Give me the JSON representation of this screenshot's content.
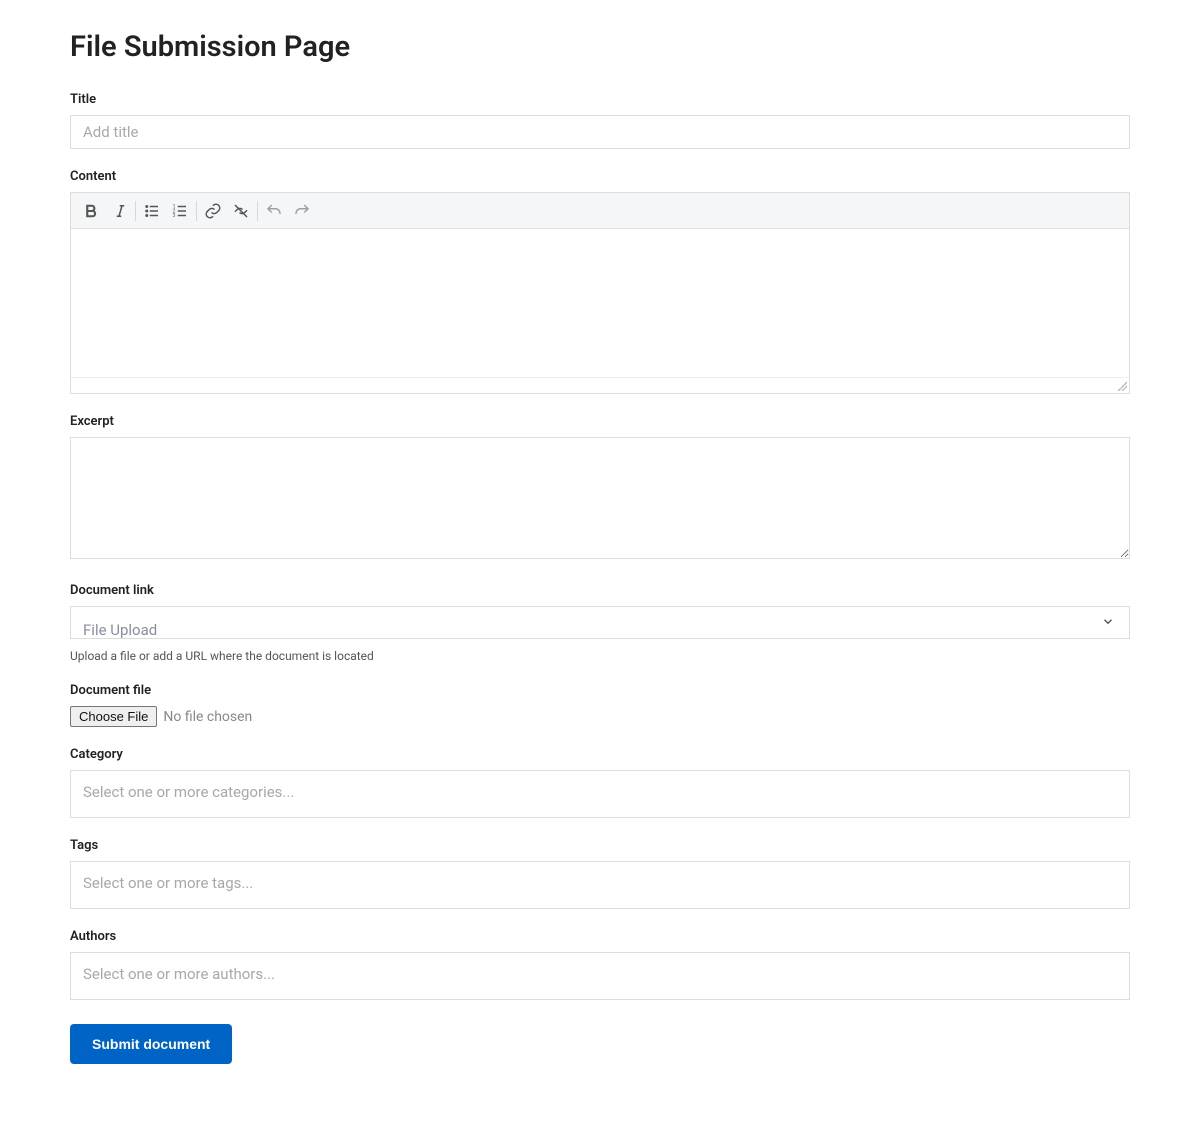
{
  "page": {
    "title": "File Submission Page"
  },
  "fields": {
    "title": {
      "label": "Title",
      "placeholder": "Add title",
      "value": ""
    },
    "content": {
      "label": "Content",
      "value": ""
    },
    "excerpt": {
      "label": "Excerpt",
      "value": ""
    },
    "document_link": {
      "label": "Document link",
      "selected": "File Upload",
      "helper": "Upload a file or add a URL where the document is located"
    },
    "document_file": {
      "label": "Document file",
      "button": "Choose File",
      "status": "No file chosen"
    },
    "category": {
      "label": "Category",
      "placeholder": "Select one or more categories..."
    },
    "tags": {
      "label": "Tags",
      "placeholder": "Select one or more tags..."
    },
    "authors": {
      "label": "Authors",
      "placeholder": "Select one or more authors..."
    }
  },
  "toolbar": {
    "buttons": [
      "bold",
      "italic",
      "bullet-list",
      "ordered-list",
      "link",
      "unlink",
      "undo",
      "redo"
    ]
  },
  "submit": {
    "label": "Submit document"
  }
}
